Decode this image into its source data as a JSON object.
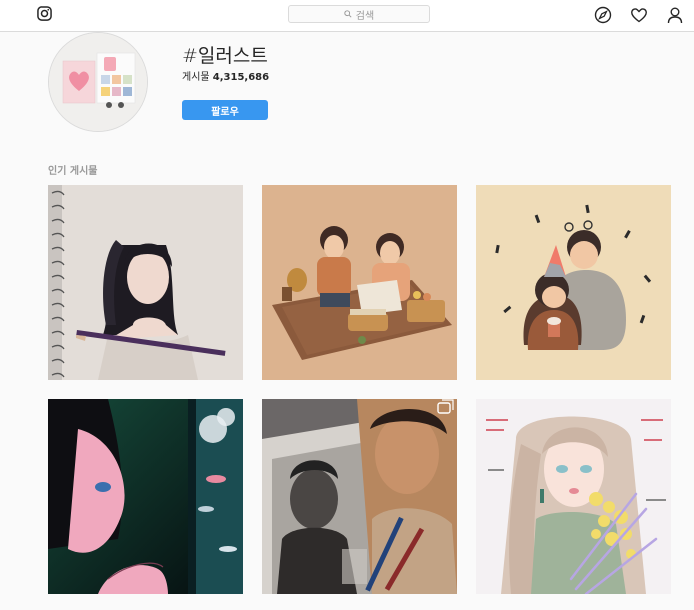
{
  "header": {
    "search_placeholder": "검색",
    "icons": [
      "instagram-logo-icon",
      "search-icon",
      "explore-compass-icon",
      "heart-icon",
      "profile-icon"
    ]
  },
  "hashtag": {
    "title": "#일러스트",
    "posts_label": "게시물",
    "posts_count": "4,315,686",
    "follow_label": "팔로우"
  },
  "section": {
    "top_posts_label": "인기 게시물"
  },
  "posts": [
    {
      "subject": "pencil portrait of girl with pigtails on spiral sketchbook"
    },
    {
      "subject": "two girls having a picnic"
    },
    {
      "subject": "couple with party hat and cupcake"
    },
    {
      "subject": "anime girl looking at aquarium"
    },
    {
      "subject": "pencil portrait of woman next to photo",
      "multi_image": true
    },
    {
      "subject": "watercolor girl with yellow flowers"
    }
  ],
  "colors": {
    "accent": "#3897f0",
    "background": "#fafafa",
    "border": "#dbdbdb"
  }
}
